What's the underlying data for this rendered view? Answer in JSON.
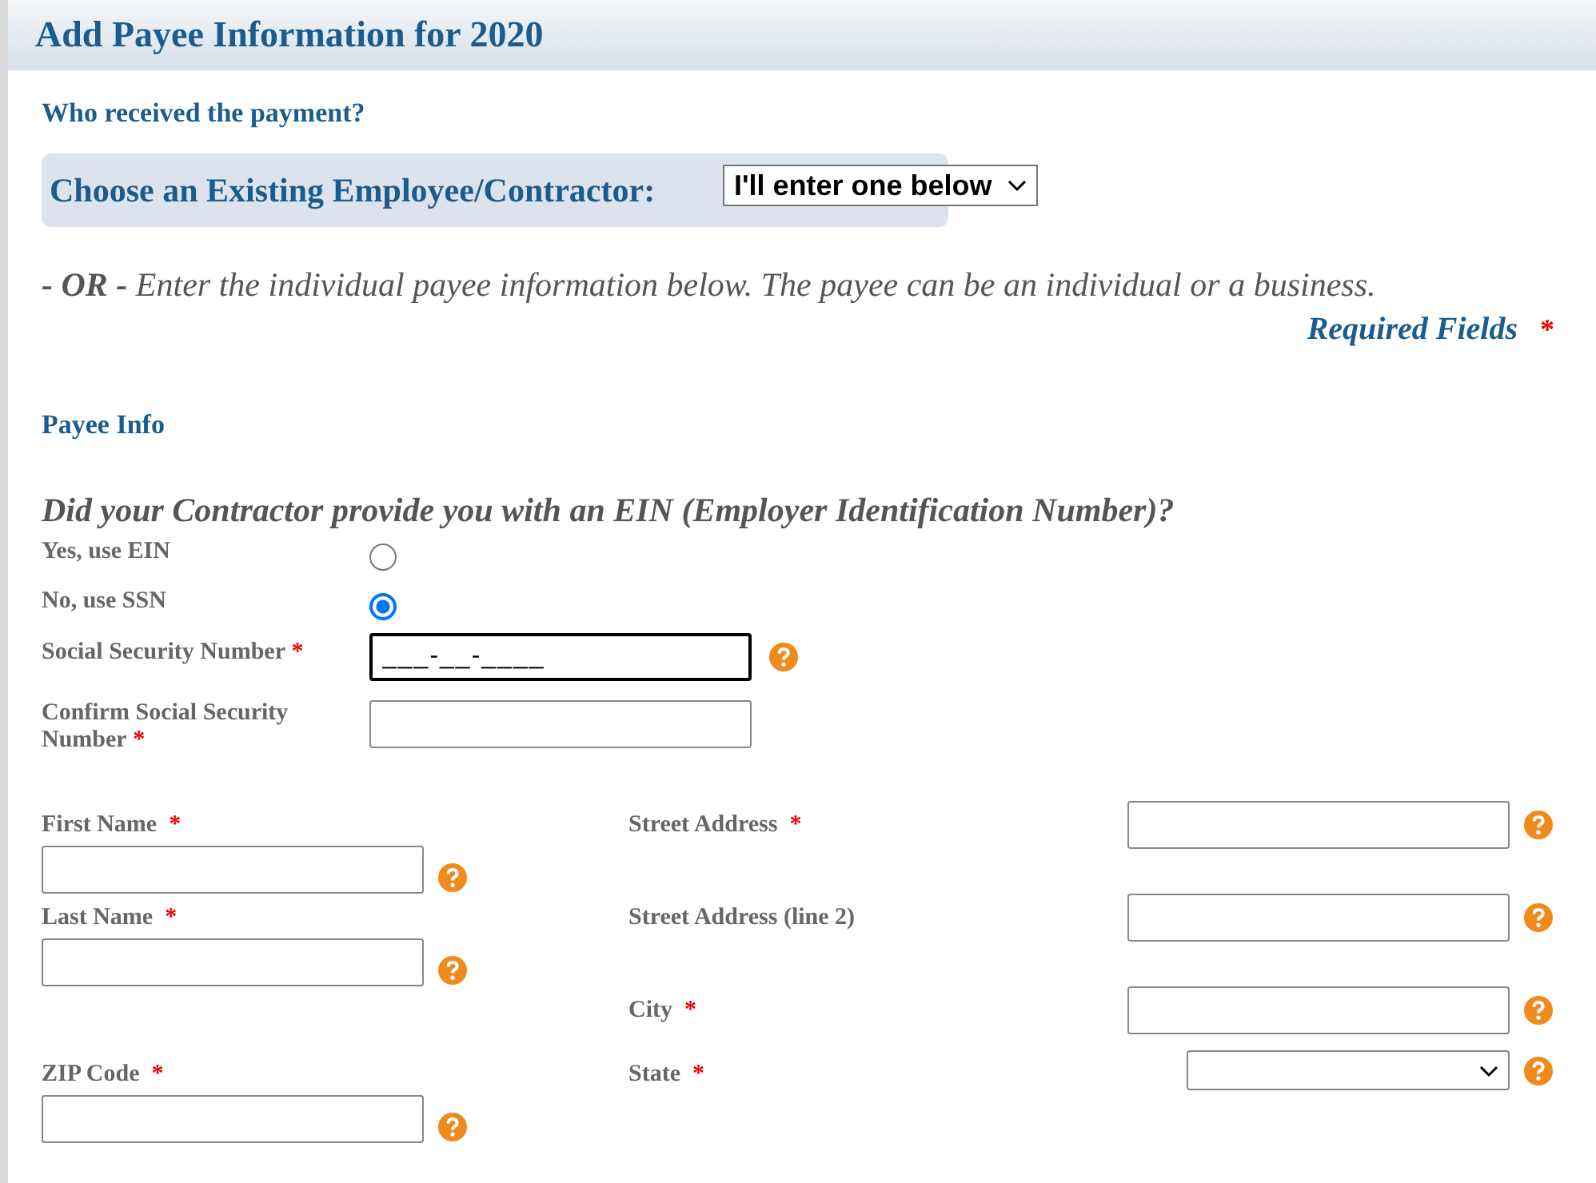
{
  "header": {
    "title": "Add Payee Information for 2020"
  },
  "who_received": "Who received the payment?",
  "existing": {
    "label": "Choose an Existing Employee/Contractor:",
    "value": "I'll enter one below"
  },
  "or_note": "**- OR -** Enter the individual payee information below. The payee can be an individual or a business.",
  "required_note": {
    "label": "Required Fields",
    "mark": "*"
  },
  "section_title": "Payee Info",
  "ein_question": {
    "question": "Did your Contractor provide you with an EIN (Employer Identification Number)?",
    "options": [
      {
        "label": "Yes, use EIN",
        "selected": false
      },
      {
        "label": "No, use SSN",
        "selected": true
      }
    ]
  },
  "ssn_fields": [
    {
      "label": "Social Security Number",
      "mark": "*",
      "value": "___-__-____",
      "focused": true,
      "help": true
    },
    {
      "label": "Confirm Social Security Number",
      "mark": "*",
      "focused": false
    }
  ],
  "left_fields": [
    {
      "label": "First Name",
      "mark": "*",
      "kind": "text"
    },
    {
      "label": "Last Name",
      "mark": "*",
      "kind": "text"
    },
    {
      "kind": "empty"
    },
    {
      "label": "ZIP Code",
      "mark": "*",
      "kind": "text"
    }
  ],
  "right_fields": [
    {
      "label": "Street Address",
      "mark": "*",
      "kind": "text"
    },
    {
      "label": "Street Address (line 2)",
      "kind": "text"
    },
    {
      "label": "City",
      "mark": "*",
      "kind": "text"
    },
    {
      "label": "State",
      "mark": "*",
      "kind": "select"
    }
  ]
}
